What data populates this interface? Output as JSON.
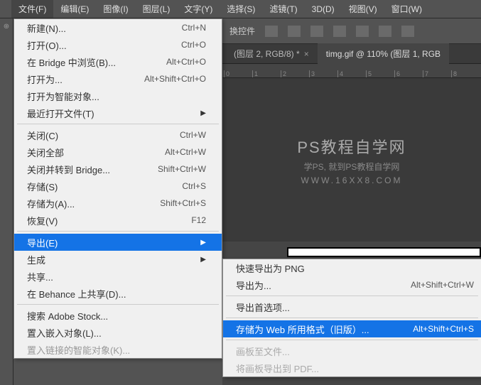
{
  "menubar": {
    "items": [
      {
        "label": "文件(F)"
      },
      {
        "label": "编辑(E)"
      },
      {
        "label": "图像(I)"
      },
      {
        "label": "图层(L)"
      },
      {
        "label": "文字(Y)"
      },
      {
        "label": "选择(S)"
      },
      {
        "label": "滤镜(T)"
      },
      {
        "label": "3D(D)"
      },
      {
        "label": "视图(V)"
      },
      {
        "label": "窗口(W)"
      }
    ]
  },
  "file_menu": {
    "items": [
      {
        "label": "新建(N)...",
        "shortcut": "Ctrl+N"
      },
      {
        "label": "打开(O)...",
        "shortcut": "Ctrl+O"
      },
      {
        "label": "在 Bridge 中浏览(B)...",
        "shortcut": "Alt+Ctrl+O"
      },
      {
        "label": "打开为...",
        "shortcut": "Alt+Shift+Ctrl+O"
      },
      {
        "label": "打开为智能对象..."
      },
      {
        "label": "最近打开文件(T)",
        "arrow": true
      },
      {
        "sep": true
      },
      {
        "label": "关闭(C)",
        "shortcut": "Ctrl+W"
      },
      {
        "label": "关闭全部",
        "shortcut": "Alt+Ctrl+W"
      },
      {
        "label": "关闭并转到 Bridge...",
        "shortcut": "Shift+Ctrl+W"
      },
      {
        "label": "存储(S)",
        "shortcut": "Ctrl+S"
      },
      {
        "label": "存储为(A)...",
        "shortcut": "Shift+Ctrl+S"
      },
      {
        "label": "恢复(V)",
        "shortcut": "F12"
      },
      {
        "sep": true
      },
      {
        "label": "导出(E)",
        "arrow": true,
        "highlight": true
      },
      {
        "label": "生成",
        "arrow": true
      },
      {
        "label": "共享..."
      },
      {
        "label": "在 Behance 上共享(D)..."
      },
      {
        "sep": true
      },
      {
        "label": "搜索 Adobe Stock..."
      },
      {
        "label": "置入嵌入对象(L)..."
      },
      {
        "label": "置入链接的智能对象(K)...",
        "disabled": true
      }
    ]
  },
  "export_submenu": {
    "items": [
      {
        "label": "快速导出为 PNG"
      },
      {
        "label": "导出为...",
        "shortcut": "Alt+Shift+Ctrl+W"
      },
      {
        "sep": true
      },
      {
        "label": "导出首选项..."
      },
      {
        "sep": true
      },
      {
        "label": "存储为 Web 所用格式（旧版）...",
        "shortcut": "Alt+Shift+Ctrl+S",
        "highlight": true
      },
      {
        "sep": true
      },
      {
        "label": "画板至文件...",
        "disabled": true
      },
      {
        "label": "将画板导出到 PDF...",
        "disabled": true
      }
    ]
  },
  "options_bar": {
    "label": "换控件"
  },
  "tabs": {
    "tab1": "(图层 2, RGB/8) *",
    "tab2": "timg.gif @ 110% (图层 1, RGB"
  },
  "ruler": [
    "0",
    "1",
    "2",
    "3",
    "4",
    "5",
    "6",
    "7",
    "8"
  ],
  "watermark": {
    "line1": "PS教程自学网",
    "line2": "学PS, 就到PS教程自学网",
    "line3": "WWW.16XX8.COM"
  }
}
